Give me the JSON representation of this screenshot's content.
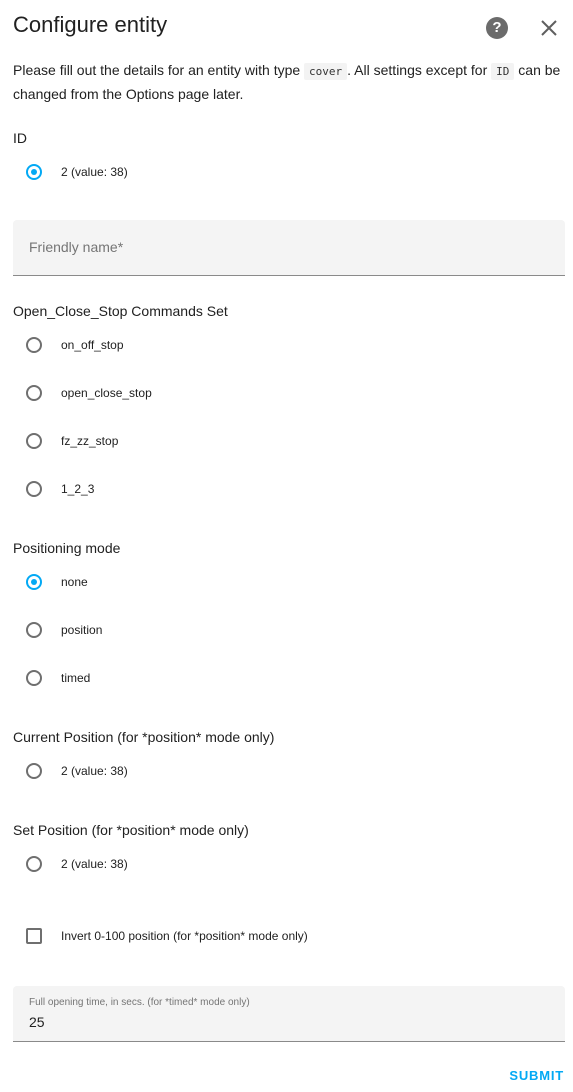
{
  "dialog": {
    "title": "Configure entity",
    "description_before": "Please fill out the details for an entity with type ",
    "entity_type": "cover",
    "description_middle": ". All settings except for ",
    "locked_field": "ID",
    "description_after": " can be changed from the Options page later."
  },
  "id_section": {
    "label": "ID",
    "options": [
      {
        "label": "2 (value: 38)",
        "checked": true
      }
    ]
  },
  "friendly_name": {
    "placeholder": "Friendly name*",
    "value": ""
  },
  "commands_section": {
    "label": "Open_Close_Stop Commands Set",
    "options": [
      {
        "label": "on_off_stop",
        "checked": false
      },
      {
        "label": "open_close_stop",
        "checked": false
      },
      {
        "label": "fz_zz_stop",
        "checked": false
      },
      {
        "label": "1_2_3",
        "checked": false
      }
    ]
  },
  "positioning_section": {
    "label": "Positioning mode",
    "options": [
      {
        "label": "none",
        "checked": true
      },
      {
        "label": "position",
        "checked": false
      },
      {
        "label": "timed",
        "checked": false
      }
    ]
  },
  "current_position_section": {
    "label": "Current Position (for *position* mode only)",
    "options": [
      {
        "label": "2 (value: 38)",
        "checked": false
      }
    ]
  },
  "set_position_section": {
    "label": "Set Position (for *position* mode only)",
    "options": [
      {
        "label": "2 (value: 38)",
        "checked": false
      }
    ]
  },
  "invert_checkbox": {
    "label": "Invert 0-100 position (for *position* mode only)",
    "checked": false
  },
  "opening_time": {
    "label": "Full opening time, in secs. (for *timed* mode only)",
    "value": "25"
  },
  "submit_label": "SUBMIT",
  "colors": {
    "accent": "#03a9f4",
    "text": "#212121",
    "secondary_text": "#757575",
    "field_background": "#f4f4f4"
  },
  "icons": {
    "help": "help-circle-icon",
    "close": "close-icon"
  }
}
